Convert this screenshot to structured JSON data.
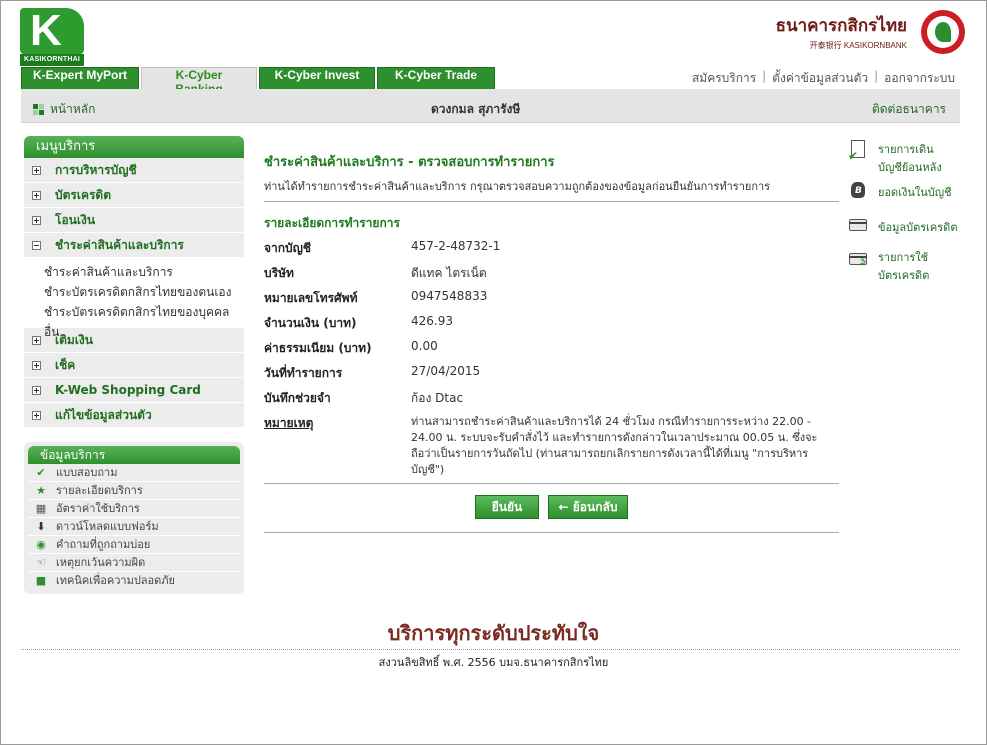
{
  "brand": {
    "logo_text": "KASIKORNTHAI",
    "bank_name_th": "ธนาคารกสิกรไทย",
    "bank_name_en": "开泰银行 KASIKORNBANK"
  },
  "tabs": [
    {
      "label": "K-Expert MyPort",
      "active": false
    },
    {
      "label": "K-Cyber Banking",
      "active": true
    },
    {
      "label": "K-Cyber Invest",
      "active": false
    },
    {
      "label": "K-Cyber Trade",
      "active": false
    }
  ],
  "top_links": [
    "สมัครบริการ",
    "ตั้งค่าข้อมูลส่วนตัว",
    "ออกจากระบบ"
  ],
  "bar": {
    "home": "หน้าหลัก",
    "user": "ดวงกมล สุภารังษี",
    "contact": "ติดต่อธนาคาร"
  },
  "menu": {
    "title": "เมนูบริการ",
    "items": [
      "การบริหารบัญชี",
      "บัตรเครดิต",
      "โอนเงิน",
      "ชำระค่าสินค้าและบริการ",
      "เติมเงิน",
      "เช็ค",
      "K-Web Shopping Card",
      "แก้ไขข้อมูลส่วนตัว"
    ],
    "sub_items": [
      "ชำระค่าสินค้าและบริการ",
      "ชำระบัตรเครดิตกสิกรไทยของตนเอง",
      "ชำระบัตรเครดิตกสิกรไทยของบุคคลอื่น"
    ]
  },
  "info": {
    "title": "ข้อมูลบริการ",
    "items": [
      {
        "label": "แบบสอบถาม",
        "icon": "check-icon"
      },
      {
        "label": "รายละเอียดบริการ",
        "icon": "star-icon"
      },
      {
        "label": "อัตราค่าใช้บริการ",
        "icon": "calculator-icon"
      },
      {
        "label": "ดาวน์โหลดแบบฟอร์ม",
        "icon": "download-icon"
      },
      {
        "label": "คำถามที่ถูกถามบ่อย",
        "icon": "faq-icon"
      },
      {
        "label": "เหตุยกเว้นความผิด",
        "icon": "hand-icon"
      },
      {
        "label": "เทคนิคเพื่อความปลอดภัย",
        "icon": "lock-icon"
      }
    ]
  },
  "content": {
    "title": "ชำระค่าสินค้าและบริการ - ตรวจสอบการทำรายการ",
    "description": "ท่านได้ทำรายการชำระค่าสินค้าและบริการ กรุณาตรวจสอบความถูกต้องของข้อมูลก่อนยืนยันการทำรายการ",
    "section_title": "รายละเอียดการทำรายการ",
    "rows": [
      {
        "label": "จากบัญชี",
        "value": "457-2-48732-1"
      },
      {
        "label": "บริษัท",
        "value": "ดีแทค ไตรเน็ต"
      },
      {
        "label": "หมายเลขโทรศัพท์",
        "value": "0947548833"
      },
      {
        "label": "จำนวนเงิน (บาท)",
        "value": "426.93"
      },
      {
        "label": "ค่าธรรมเนียม (บาท)",
        "value": "0.00"
      },
      {
        "label": "วันที่ทำรายการ",
        "value": "27/04/2015"
      },
      {
        "label": "บันทึกช่วยจำ",
        "value": "ก้อง Dtac"
      }
    ],
    "note_label": "หมายเหตุ",
    "note_text": "ท่านสามารถชำระค่าสินค้าและบริการได้ 24 ชั่วโมง กรณีทำรายการระหว่าง 22.00 - 24.00 น. ระบบจะรับคำสั่งไว้ และทำรายการดังกล่าวในเวลาประมาณ 00.05 น. ซึ่งจะถือว่าเป็นรายการวันถัดไป (ท่านสามารถยกเลิกรายการดังเวลานี้ได้ที่เมนู \"การบริหารบัญชี\")",
    "confirm": "ยืนยัน",
    "back": "ย้อนกลับ"
  },
  "right_links": [
    {
      "label": "รายการเดินบัญชีย้อนหลัง",
      "line1": "รายการเดิน",
      "line2": "บัญชีย้อนหลัง",
      "icon": "statement-icon"
    },
    {
      "label": "ยอดเงินในบัญชี",
      "line1": "ยอดเงินในบัญชี",
      "line2": "",
      "icon": "money-bag-icon"
    },
    {
      "label": "ข้อมูลบัตรเครดิต",
      "line1": "ข้อมูลบัตรเครดิต",
      "line2": "",
      "icon": "credit-card-icon"
    },
    {
      "label": "รายการใช้บัตรเครดิต",
      "line1": "รายการใช้",
      "line2": "บัตรเครดิต",
      "icon": "card-usage-icon"
    }
  ],
  "footer": {
    "slogan": "บริการทุกระดับประทับใจ",
    "copyright": "สงวนลิขสิทธิ์ พ.ศ. 2556 บมจ.ธนาคารกสิกรไทย"
  },
  "colors": {
    "brand_green": "#2e8f2e",
    "title_green": "#1f7a1f",
    "bank_red": "#cc1e1e",
    "slogan_brown": "#7a2a20"
  }
}
